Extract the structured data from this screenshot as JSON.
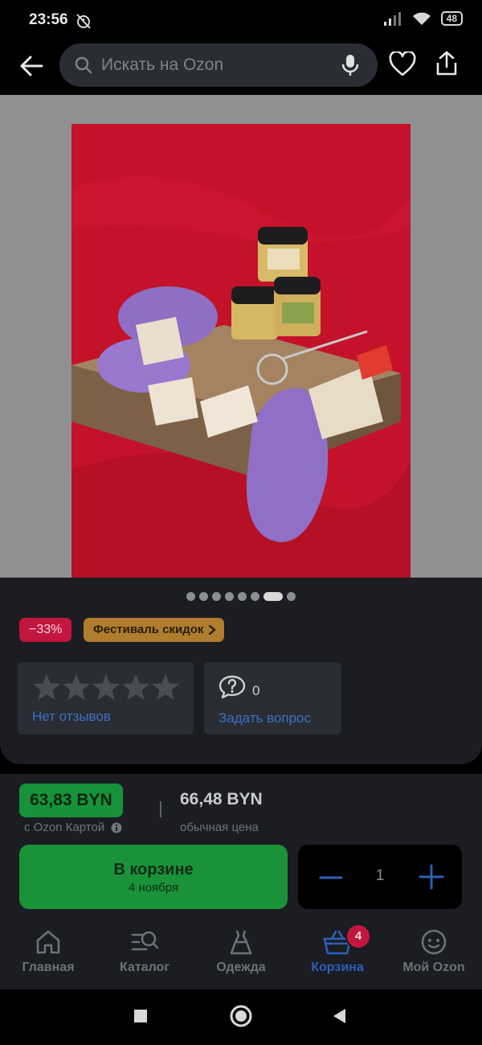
{
  "status_bar": {
    "time": "23:56",
    "battery": "48"
  },
  "header": {
    "search_placeholder": "Искать на Ozon"
  },
  "gallery": {
    "dots_total": 8,
    "active_dot": 7
  },
  "badges": {
    "discount": "−33%",
    "festival": "Фестиваль скидок"
  },
  "reviews": {
    "label": "Нет отзывов",
    "stars": 5
  },
  "questions": {
    "count": "0",
    "label": "Задать вопрос"
  },
  "price": {
    "ozon_price": "63,83 BYN",
    "ozon_note": "с Ozon Картой",
    "regular_price": "66,48 BYN",
    "regular_note": "обычная цена"
  },
  "cart_button": {
    "title": "В корзине",
    "subtitle": "4 ноября"
  },
  "stepper": {
    "quantity": "1"
  },
  "nav": {
    "home": "Главная",
    "catalog": "Каталог",
    "clothes": "Одежда",
    "cart": "Корзина",
    "cart_count": "4",
    "profile": "Мой Ozon"
  },
  "colors": {
    "accent_green": "#1a9338",
    "accent_blue": "#2c5fb7",
    "discount_red": "#c2163f",
    "festival_gold": "#b07c2e"
  }
}
